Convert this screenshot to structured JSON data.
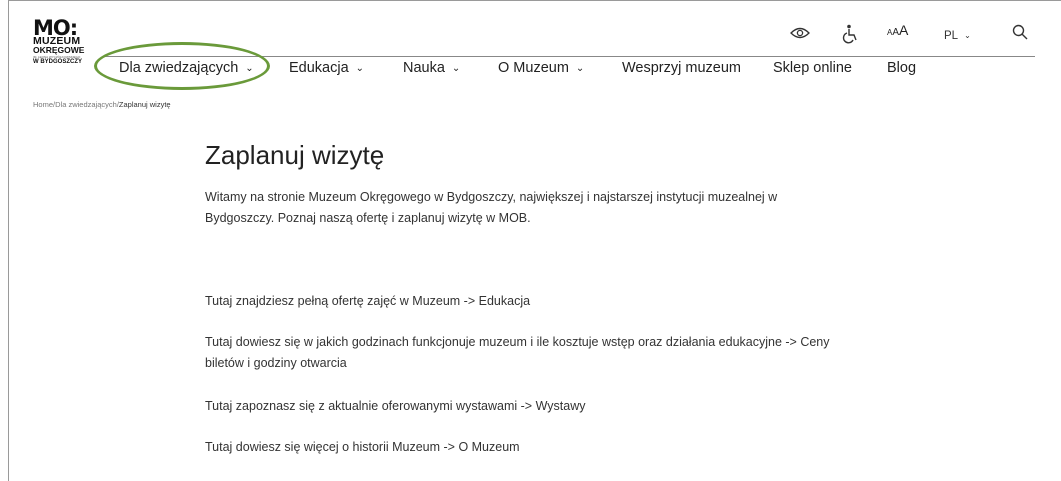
{
  "logo": {
    "mark": "MO:",
    "line1": "MUZEUM",
    "line2": "OKRĘGOWE",
    "line3": "IM. LEONA WYCZÓŁKOWSKIEGO",
    "line4": "W BYDGOSZCZY"
  },
  "nav": {
    "items": [
      {
        "label": "Dla zwiedzających",
        "dropdown": true
      },
      {
        "label": "Edukacja",
        "dropdown": true
      },
      {
        "label": "Nauka",
        "dropdown": true
      },
      {
        "label": "O Muzeum",
        "dropdown": true
      },
      {
        "label": "Wesprzyj muzeum",
        "dropdown": false
      },
      {
        "label": "Sklep online",
        "dropdown": false
      },
      {
        "label": "Blog",
        "dropdown": false
      }
    ],
    "chevron": "⌄",
    "highlight_color": "#6a9a3a"
  },
  "tools": {
    "eye_icon": "eye-icon",
    "accessibility_icon": "wheelchair-icon",
    "font_size": {
      "small": "A",
      "medium": "A",
      "large": "A"
    },
    "language": "PL",
    "search_icon": "search-icon"
  },
  "breadcrumb": {
    "home": "Home",
    "sep1": "/",
    "parent": "Dla zwiedzających",
    "sep2": "/",
    "current": "Zaplanuj wizytę"
  },
  "content": {
    "title": "Zaplanuj wizytę",
    "intro": "Witamy na stronie Muzeum Okręgowego w Bydgoszczy, największej i najstarszej instytucji muzealnej w Bydgoszczy. Poznaj naszą ofertę i zaplanuj wizytę w MOB.",
    "p1": "Tutaj znajdziesz pełną ofertę zajęć w Muzeum ->  Edukacja",
    "p2": "Tutaj dowiesz się w jakich godzinach funkcjonuje muzeum i ile kosztuje wstęp oraz działania edukacyjne -> Ceny biletów i godziny otwarcia",
    "p3": "Tutaj zapoznasz się z aktualnie oferowanymi wystawami -> Wystawy",
    "p4": "Tutaj dowiesz się więcej o historii Muzeum -> O Muzeum"
  }
}
